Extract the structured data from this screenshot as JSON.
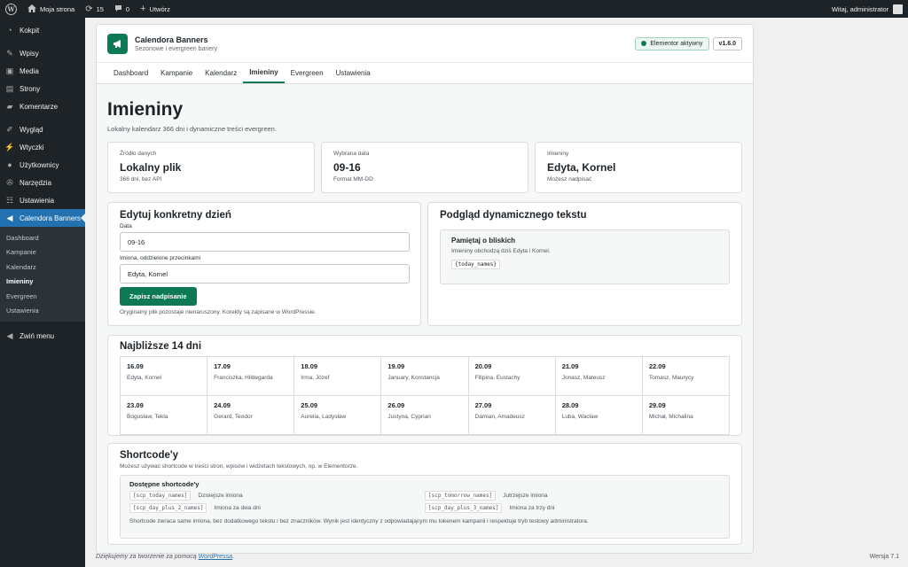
{
  "adminbar": {
    "site_name": "Moja strona",
    "updates_count": "15",
    "comments_count": "0",
    "new_label": "Utwórz",
    "greeting": "Witaj, administrator"
  },
  "sidebar": {
    "items": [
      {
        "label": "Kokpit",
        "icon": "dashboard-icon"
      },
      {
        "label": "Wpisy",
        "icon": "pin-icon"
      },
      {
        "label": "Media",
        "icon": "media-icon"
      },
      {
        "label": "Strony",
        "icon": "page-icon"
      },
      {
        "label": "Komentarze",
        "icon": "comment-icon"
      },
      {
        "label": "Wygląd",
        "icon": "brush-icon"
      },
      {
        "label": "Wtyczki",
        "icon": "plugin-icon"
      },
      {
        "label": "Użytkownicy",
        "icon": "users-icon"
      },
      {
        "label": "Narzędzia",
        "icon": "wrench-icon"
      },
      {
        "label": "Ustawienia",
        "icon": "settings-icon"
      },
      {
        "label": "Calendora Banners",
        "icon": "megaphone-icon"
      }
    ],
    "submenu": [
      "Dashboard",
      "Kampanie",
      "Kalendarz",
      "Imieniny",
      "Evergreen",
      "Ustawienia"
    ],
    "collapse_label": "Zwiń menu"
  },
  "plugin": {
    "name": "Calendora Banners",
    "subtitle": "Sezonowe i evergreen banery",
    "status_badge": "Elementor aktywny",
    "version": "v1.6.0",
    "tabs": [
      "Dashboard",
      "Kampanie",
      "Kalendarz",
      "Imieniny",
      "Evergreen",
      "Ustawienia"
    ]
  },
  "page": {
    "title": "Imieniny",
    "description": "Lokalny kalendarz 366 dni i dynamiczne treści evergreen."
  },
  "stats": [
    {
      "label": "Źródło danych",
      "value": "Lokalny plik",
      "note": "366 dni, bez API"
    },
    {
      "label": "Wybrana data",
      "value": "09-16",
      "note": "Format MM-DD"
    },
    {
      "label": "Imieniny",
      "value": "Edyta, Kornel",
      "note": "Możesz nadpisać"
    }
  ],
  "edit": {
    "title": "Edytuj konkretny dzień",
    "date_label": "Data",
    "date_value": "09-16",
    "names_label": "Imiona, oddzielone przecinkami",
    "names_value": "Edyta, Kornel",
    "save_label": "Zapisz nadpisanie",
    "helper": "Oryginalny plik pozostaje nienaruszony. Korekty są zapisane w WordPressie."
  },
  "preview": {
    "title": "Podgląd dynamicznego tekstu",
    "box_title": "Pamiętaj o bliskich",
    "box_text": "Imieniny obchodzą dziś Edyta i Kornel.",
    "token": "{today_names}"
  },
  "upcoming": {
    "title": "Najbliższe 14 dni",
    "days": [
      {
        "date": "16.09",
        "names": "Edyta, Kornel"
      },
      {
        "date": "17.09",
        "names": "Franciszka, Hildegarda"
      },
      {
        "date": "18.09",
        "names": "Irma, Józef"
      },
      {
        "date": "19.09",
        "names": "January, Konstancja"
      },
      {
        "date": "20.09",
        "names": "Filipina, Eustachy"
      },
      {
        "date": "21.09",
        "names": "Jonasz, Mateusz"
      },
      {
        "date": "22.09",
        "names": "Tomasz, Maurycy"
      },
      {
        "date": "23.09",
        "names": "Bogusław, Tekla"
      },
      {
        "date": "24.09",
        "names": "Gerard, Teodor"
      },
      {
        "date": "25.09",
        "names": "Aurelia, Ladysław"
      },
      {
        "date": "26.09",
        "names": "Justyna, Cyprian"
      },
      {
        "date": "27.09",
        "names": "Damian, Amadeusz"
      },
      {
        "date": "28.09",
        "names": "Luba, Wacław"
      },
      {
        "date": "29.09",
        "names": "Michał, Michalina"
      }
    ]
  },
  "shortcodes": {
    "title": "Shortcode'y",
    "description": "Możesz używać shortcode w treści stron, wpisów i widżetach tekstowych, np. w Elementorze.",
    "box_title": "Dostępne shortcode'y",
    "items": [
      {
        "code": "[scp_today_names]",
        "desc": "Dzisiejsze imiona"
      },
      {
        "code": "[scp_tomorrow_names]",
        "desc": "Jutrzejsze imiona"
      },
      {
        "code": "[scp_day_plus_2_names]",
        "desc": "Imiona za dwa dni"
      },
      {
        "code": "[scp_day_plus_3_names]",
        "desc": "Imiona za trzy dni"
      }
    ],
    "note": "Shortcode zwraca same imiona, bez dodatkowego tekstu i bez znaczników. Wynik jest identyczny z odpowiadającym mu tokenem kampanii i respektuje tryb testowy administratora."
  },
  "footer": {
    "thanks_prefix": "Dziękujemy za tworzenie za pomocą",
    "link": "WordPressa",
    "thanks_suffix": ".",
    "version": "Wersja 7.1"
  }
}
